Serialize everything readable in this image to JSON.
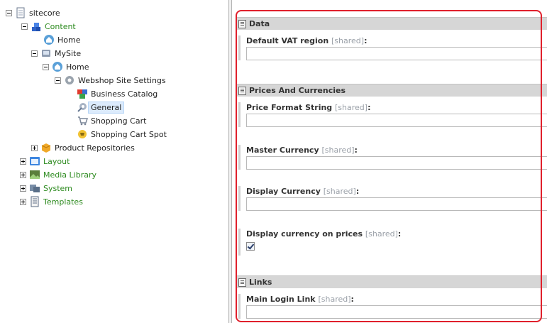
{
  "tree": {
    "root": "sitecore",
    "content": "Content",
    "home_1": "Home",
    "mysite": "MySite",
    "home_2": "Home",
    "webshop_settings": "Webshop Site Settings",
    "business_catalog": "Business Catalog",
    "general": "General",
    "shopping_cart": "Shopping Cart",
    "shopping_cart_spot": "Shopping Cart Spot",
    "product_repositories": "Product Repositories",
    "layout": "Layout",
    "media_library": "Media Library",
    "system": "System",
    "templates": "Templates"
  },
  "editor": {
    "sections": {
      "data": "Data",
      "prices": "Prices And Currencies",
      "links": "Links"
    },
    "shared_tag": "[shared]",
    "fields": {
      "default_vat_region": "Default VAT region",
      "price_format_string": "Price Format String",
      "master_currency": "Master Currency",
      "display_currency": "Display Currency",
      "display_currency_on_prices": "Display currency on prices",
      "main_login_link": "Main Login Link"
    },
    "display_currency_on_prices_checked": true
  },
  "colors": {
    "highlight": "#e0202c",
    "tree_green_text": "#2c8a1e",
    "section_bg": "#d6d6d6"
  }
}
